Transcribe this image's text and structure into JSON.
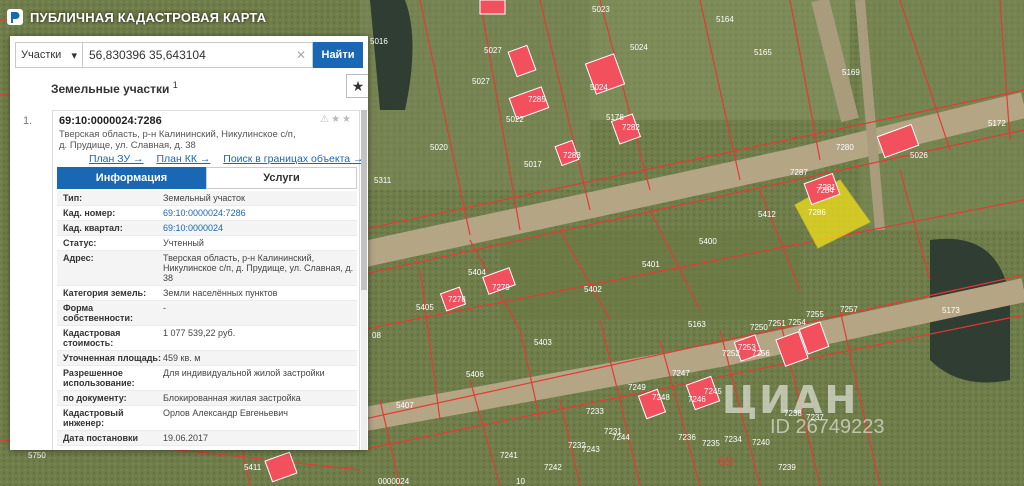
{
  "app": {
    "title": "ПУБЛИЧНАЯ КАДАСТРОВАЯ КАРТА"
  },
  "search": {
    "category": "Участки",
    "query": "56,830396 35,643104",
    "button": "Найти"
  },
  "section": {
    "title": "Земельные участки",
    "count": "1"
  },
  "result": {
    "index": "1.",
    "cad_number": "69:10:0000024:7286",
    "address": "Тверская область, р-н Калининский, Никулинское с/п, д. Прудище, ул. Славная, д. 38",
    "links": [
      "План ЗУ →",
      "План КК →",
      "Поиск в границах объекта →"
    ]
  },
  "tabs": {
    "info": "Информация",
    "services": "Услуги"
  },
  "details": [
    {
      "k": "Тип:",
      "v": "Земельный участок"
    },
    {
      "k": "Кад. номер:",
      "v": "69:10:0000024:7286"
    },
    {
      "k": "Кад. квартал:",
      "v": "69:10:0000024"
    },
    {
      "k": "Статус:",
      "v": "Учтенный"
    },
    {
      "k": "Адрес:",
      "v": "Тверская область, р-н Калининский, Никулинское с/п, д. Прудище, ул. Славная, д. 38"
    },
    {
      "k": "Категория земель:",
      "v": "Земли населённых пунктов"
    },
    {
      "k": "Форма собственности:",
      "v": "-"
    },
    {
      "k": "Кадастровая стоимость:",
      "v": "1 077 539,22 руб."
    },
    {
      "k": "Уточненная площадь:",
      "v": "459 кв. м"
    },
    {
      "k": "Разрешенное использование:",
      "v": "Для индивидуальной жилой застройки"
    },
    {
      "k": "по документу:",
      "v": "Блокированная жилая застройка"
    },
    {
      "k": "Кадастровый инженер:",
      "v": "Орлов Александр Евгеньевич"
    },
    {
      "k": "Дата постановки",
      "v": "19.06.2017"
    }
  ],
  "map_labels": [
    "5023",
    "5164",
    "5016",
    "5027",
    "5024",
    "5165",
    "5169",
    "5027",
    "7285",
    "5022",
    "5024",
    "5178",
    "7282",
    "5172",
    "5020",
    "7281",
    "5017",
    "7283",
    "7280",
    "5026",
    "5311",
    "7287",
    "7284",
    "7286",
    "5412",
    "5400",
    "5401",
    "5404",
    "7279",
    "5405",
    "7278",
    "5402",
    "5403",
    "5163",
    "7257",
    "5173",
    "5406",
    "5407",
    "5750",
    "5411",
    "7250",
    "7251",
    "7252",
    "7253",
    "7254",
    "7255",
    "7256",
    "7249",
    "7248",
    "7247",
    "7246",
    "7245",
    "7244",
    "7243",
    "7242",
    "7241",
    "7240",
    "7239",
    "7238",
    "7237",
    "7236",
    "7235",
    "7234",
    "7233",
    "7232",
    "7231",
    "69",
    "10",
    "0000024",
    "08"
  ],
  "watermark": {
    "brand": "ЦИАН",
    "id": "ID 26749223"
  },
  "colors": {
    "accent": "#1a67b4",
    "parcel_fill": "#f3505e",
    "highlight": "#f2e01c",
    "boundary": "#e53935"
  }
}
